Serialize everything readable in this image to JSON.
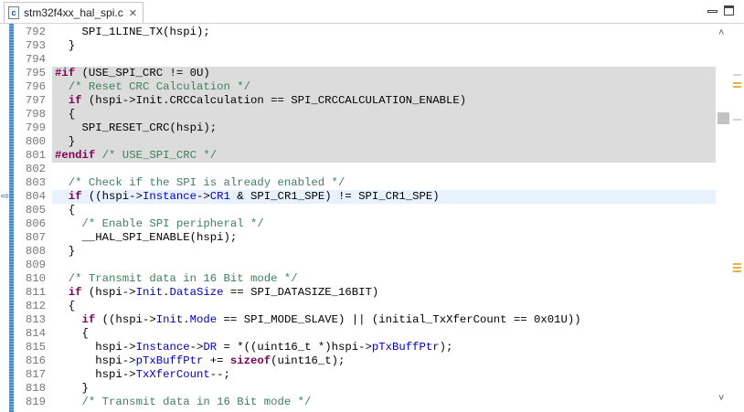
{
  "tab": {
    "icon": "c-source-file-icon",
    "icon_letter": "c",
    "title": "stm32f4xx_hal_spi.c",
    "close_glyph": "✕"
  },
  "window": {
    "minimize": "minimize-icon",
    "maximize": "maximize-icon"
  },
  "editor": {
    "current_line": 804,
    "debug_arrow": "⇨",
    "lines": [
      {
        "num": "792",
        "html": "    SPI_1LINE_TX(hspi);"
      },
      {
        "num": "793",
        "html": "  }"
      },
      {
        "num": "794",
        "html": ""
      },
      {
        "num": "795",
        "html": "<span class=\"kw\">#if</span> (USE_SPI_CRC != 0U)"
      },
      {
        "num": "796",
        "html": "  <span class=\"cm\">/* Reset CRC Calculation */</span>"
      },
      {
        "num": "797",
        "html": "  <span class=\"kw\">if</span> (hspi->Init.CRCCalculation == SPI_CRCCALCULATION_ENABLE)"
      },
      {
        "num": "798",
        "html": "  {"
      },
      {
        "num": "799",
        "html": "    SPI_RESET_CRC(hspi);"
      },
      {
        "num": "800",
        "html": "  }"
      },
      {
        "num": "801",
        "html": "<span class=\"kw\">#endif</span> <span class=\"cm\">/* USE_SPI_CRC */</span>"
      },
      {
        "num": "802",
        "html": ""
      },
      {
        "num": "803",
        "html": "  <span class=\"cm\">/* Check if the SPI is already enabled */</span>"
      },
      {
        "num": "804",
        "html": "  <span class=\"kw\">if</span> ((hspi-><span class=\"fld\">Instance</span>-><span class=\"fld\">CR1</span> &amp; SPI_CR1_SPE) != SPI_CR1_SPE)"
      },
      {
        "num": "805",
        "html": "  {"
      },
      {
        "num": "806",
        "html": "    <span class=\"cm\">/* Enable SPI peripheral */</span>"
      },
      {
        "num": "807",
        "html": "    __HAL_SPI_ENABLE(hspi);"
      },
      {
        "num": "808",
        "html": "  }"
      },
      {
        "num": "809",
        "html": ""
      },
      {
        "num": "810",
        "html": "  <span class=\"cm\">/* Transmit data in 16 Bit mode */</span>"
      },
      {
        "num": "811",
        "html": "  <span class=\"kw\">if</span> (hspi-><span class=\"fld\">Init</span>.<span class=\"fld\">DataSize</span> == SPI_DATASIZE_16BIT)"
      },
      {
        "num": "812",
        "html": "  {"
      },
      {
        "num": "813",
        "html": "    <span class=\"kw\">if</span> ((hspi-><span class=\"fld\">Init</span>.<span class=\"fld\">Mode</span> == SPI_MODE_SLAVE) || (initial_TxXferCount == 0x01U))"
      },
      {
        "num": "814",
        "html": "    {"
      },
      {
        "num": "815",
        "html": "      hspi-><span class=\"fld\">Instance</span>-><span class=\"fld\">DR</span> = *((uint16_t *)hspi-><span class=\"fld\">pTxBuffPtr</span>);"
      },
      {
        "num": "816",
        "html": "      hspi-><span class=\"fld\">pTxBuffPtr</span> += <span class=\"kw\">sizeof</span>(uint16_t);"
      },
      {
        "num": "817",
        "html": "      hspi-><span class=\"fld\">TxXferCount</span>--;"
      },
      {
        "num": "818",
        "html": "    }"
      },
      {
        "num": "819",
        "html": "    <span class=\"cm\">/* Transmit data in 16 Bit mode */</span>"
      }
    ],
    "disabled_range": [
      "795",
      "801"
    ]
  },
  "scrollbar": {
    "up_glyph": "˄",
    "down_glyph": "˅"
  },
  "colors": {
    "keyword": "#7f0055",
    "comment": "#3f7f5f",
    "field": "#0000c0",
    "disabled_bg": "#dcdcdc",
    "current_line_bg": "#e8f2fe",
    "overview_warning": "#e5b14a"
  }
}
